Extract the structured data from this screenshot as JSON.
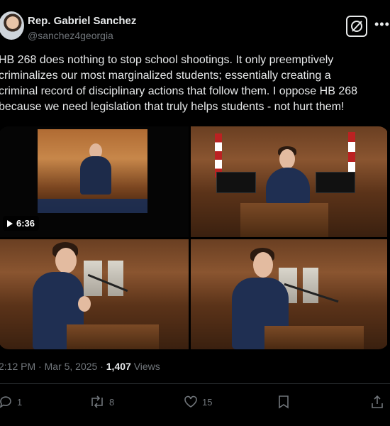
{
  "author": {
    "name": "Rep. Gabriel Sanchez",
    "handle": "@sanchez4georgia"
  },
  "post": {
    "lines": [
      "HB 268 does nothing to stop school shootings. It only preemptively",
      "criminalizes our most marginalized students; essentially creating a",
      "criminal record of disciplinary actions that follow them. I oppose HB 268",
      "because we need legislation that truly helps students - not hurt them!"
    ]
  },
  "media": {
    "video_duration": "6:36",
    "icons": {
      "play": "play-icon"
    }
  },
  "meta": {
    "time": "2:12 PM",
    "separator": "·",
    "date": "Mar 5, 2025",
    "views_count": "1,407",
    "views_label": "Views"
  },
  "actions": {
    "replies": "1",
    "reposts": "8",
    "likes": "15"
  },
  "colors": {
    "background": "#000000",
    "text": "#e7e9ea",
    "muted": "#71767b",
    "divider": "#2f3336"
  }
}
